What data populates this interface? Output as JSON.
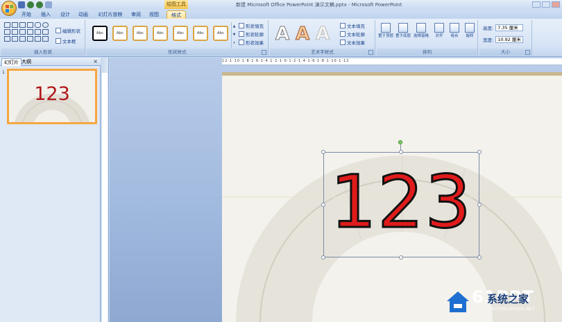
{
  "window": {
    "title": "新建 Microsoft Office PowerPoint 演示文稿.pptx - Microsoft PowerPoint",
    "context_tool": "绘图工具"
  },
  "tabs": [
    {
      "label": "开始"
    },
    {
      "label": "插入"
    },
    {
      "label": "设计"
    },
    {
      "label": "动画"
    },
    {
      "label": "幻灯片放映"
    },
    {
      "label": "审阅"
    },
    {
      "label": "视图"
    },
    {
      "label": "格式",
      "active": true
    }
  ],
  "ribbon": {
    "insert_shapes": {
      "label": "插入形状",
      "edit_shape": "编辑形状",
      "text_box": "文本框"
    },
    "shape_styles": {
      "label": "形状样式",
      "swatches": [
        "Abc",
        "Abc",
        "Abc",
        "Abc",
        "Abc",
        "Abc",
        "Abc"
      ],
      "fill": "形状填充",
      "outline": "形状轮廓",
      "effects": "形状效果"
    },
    "wordart": {
      "label": "艺术字样式",
      "letter": "A",
      "text_fill": "文本填充",
      "text_outline": "文本轮廓",
      "text_effects": "文本效果"
    },
    "arrange": {
      "label": "排列",
      "bring_front": "置于顶层",
      "send_back": "置于底层",
      "selection_pane": "选择窗格",
      "align": "对齐",
      "group": "组合",
      "rotate": "旋转"
    },
    "size": {
      "label": "大小",
      "height_label": "高度:",
      "height_value": "7.35 厘米",
      "width_label": "宽度:",
      "width_value": "10.92 厘米"
    }
  },
  "panel": {
    "tab_slides": "幻灯片",
    "tab_outline": "大纲",
    "close": "×",
    "slide_number": "1",
    "thumbnail_text": "123"
  },
  "ruler": {
    "marks": "12·1·10·1·8·1·6·1·4·1·2·1·0·1·2·1·4·1·6·1·8·1·10·1·12"
  },
  "slide": {
    "text": "123"
  },
  "watermark": {
    "brand": "61PPT",
    "cn": "系统之家",
    "url": "XITONGZHIJIA.NET"
  }
}
